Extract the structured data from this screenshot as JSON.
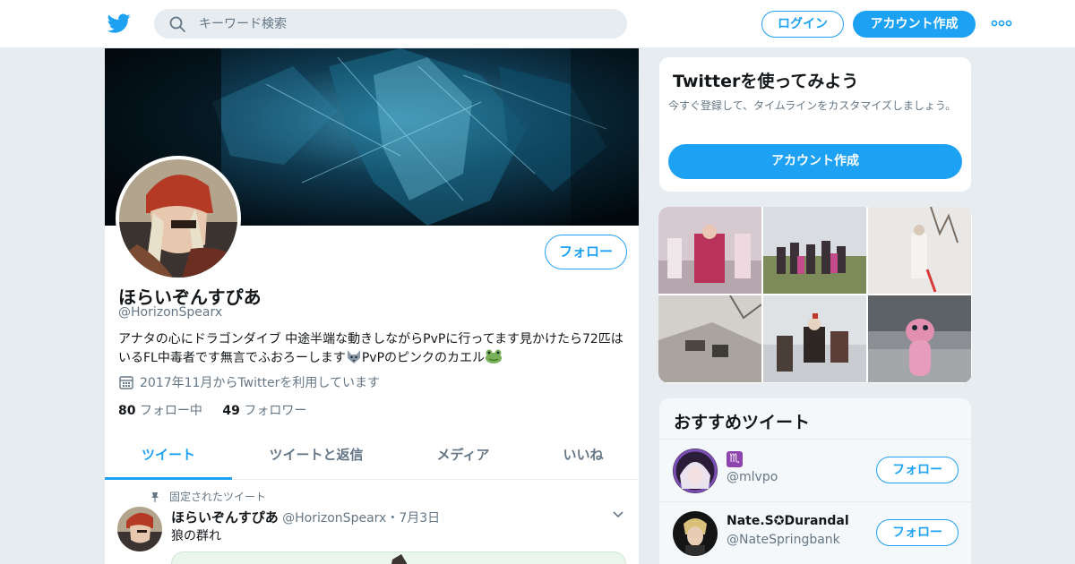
{
  "header": {
    "logo": "twitter-bird-icon",
    "search_placeholder": "キーワード検索",
    "login_label": "ログイン",
    "signup_label": "アカウント作成",
    "more_icon": "more-dots-icon"
  },
  "profile": {
    "name": "ほらいぞんすぴあ",
    "handle": "@HorizonSpearx",
    "follow_label": "フォロー",
    "bio_part1": "アナタの心にドラゴンダイブ 中途半端な動きしながらPvPに行ってます見かけたら72匹はいるFL中毒者です無言でふおろーします",
    "bio_part2": "PvPのピンクのカエル",
    "bio_emoji_1": "wolf-emoji",
    "bio_emoji_2": "frog-emoji",
    "joined": "2017年11月からTwitterを利用しています",
    "following_count": "80",
    "following_label": "フォロー中",
    "followers_count": "49",
    "followers_label": "フォロワー"
  },
  "tabs": [
    {
      "label": "ツイート",
      "active": true
    },
    {
      "label": "ツイートと返信",
      "active": false
    },
    {
      "label": "メディア",
      "active": false
    },
    {
      "label": "いいね",
      "active": false
    }
  ],
  "pinned_tweet": {
    "pinned_label": "固定されたツイート",
    "author_name": "ほらいぞんすぴあ",
    "author_handle": "@HorizonSpearx",
    "separator": "・",
    "date": "7月3日",
    "text": "狼の群れ"
  },
  "sidebar": {
    "signup_card": {
      "title": "Twitterを使ってみよう",
      "description": "今すぐ登録して、タイムラインをカスタマイズしましょう。",
      "button_label": "アカウント作成"
    },
    "recommendations": {
      "title": "おすすめツイート",
      "items": [
        {
          "name": "♏",
          "handle": "@mlvpo",
          "follow_label": "フォロー"
        },
        {
          "name": "Nate.S✪Durandal",
          "handle": "@NateSpringbank",
          "follow_label": "フォロー"
        }
      ]
    }
  },
  "colors": {
    "accent": "#1da1f2",
    "background": "#e6ecf0",
    "text": "#14171a",
    "muted": "#657786"
  }
}
